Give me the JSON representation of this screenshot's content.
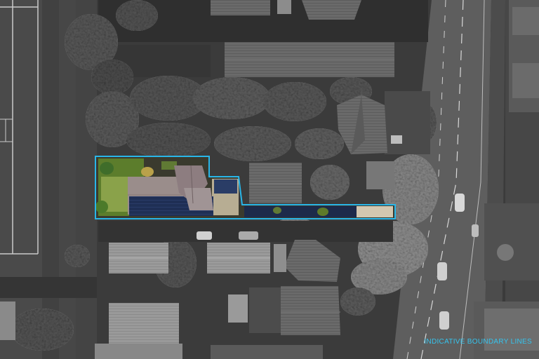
{
  "map": {
    "style": "aerial-photo-greyscale-with-colour-highlight",
    "boundary_color": "#29b6e8",
    "caption": "INDICATIVE BOUNDARY LINES"
  }
}
